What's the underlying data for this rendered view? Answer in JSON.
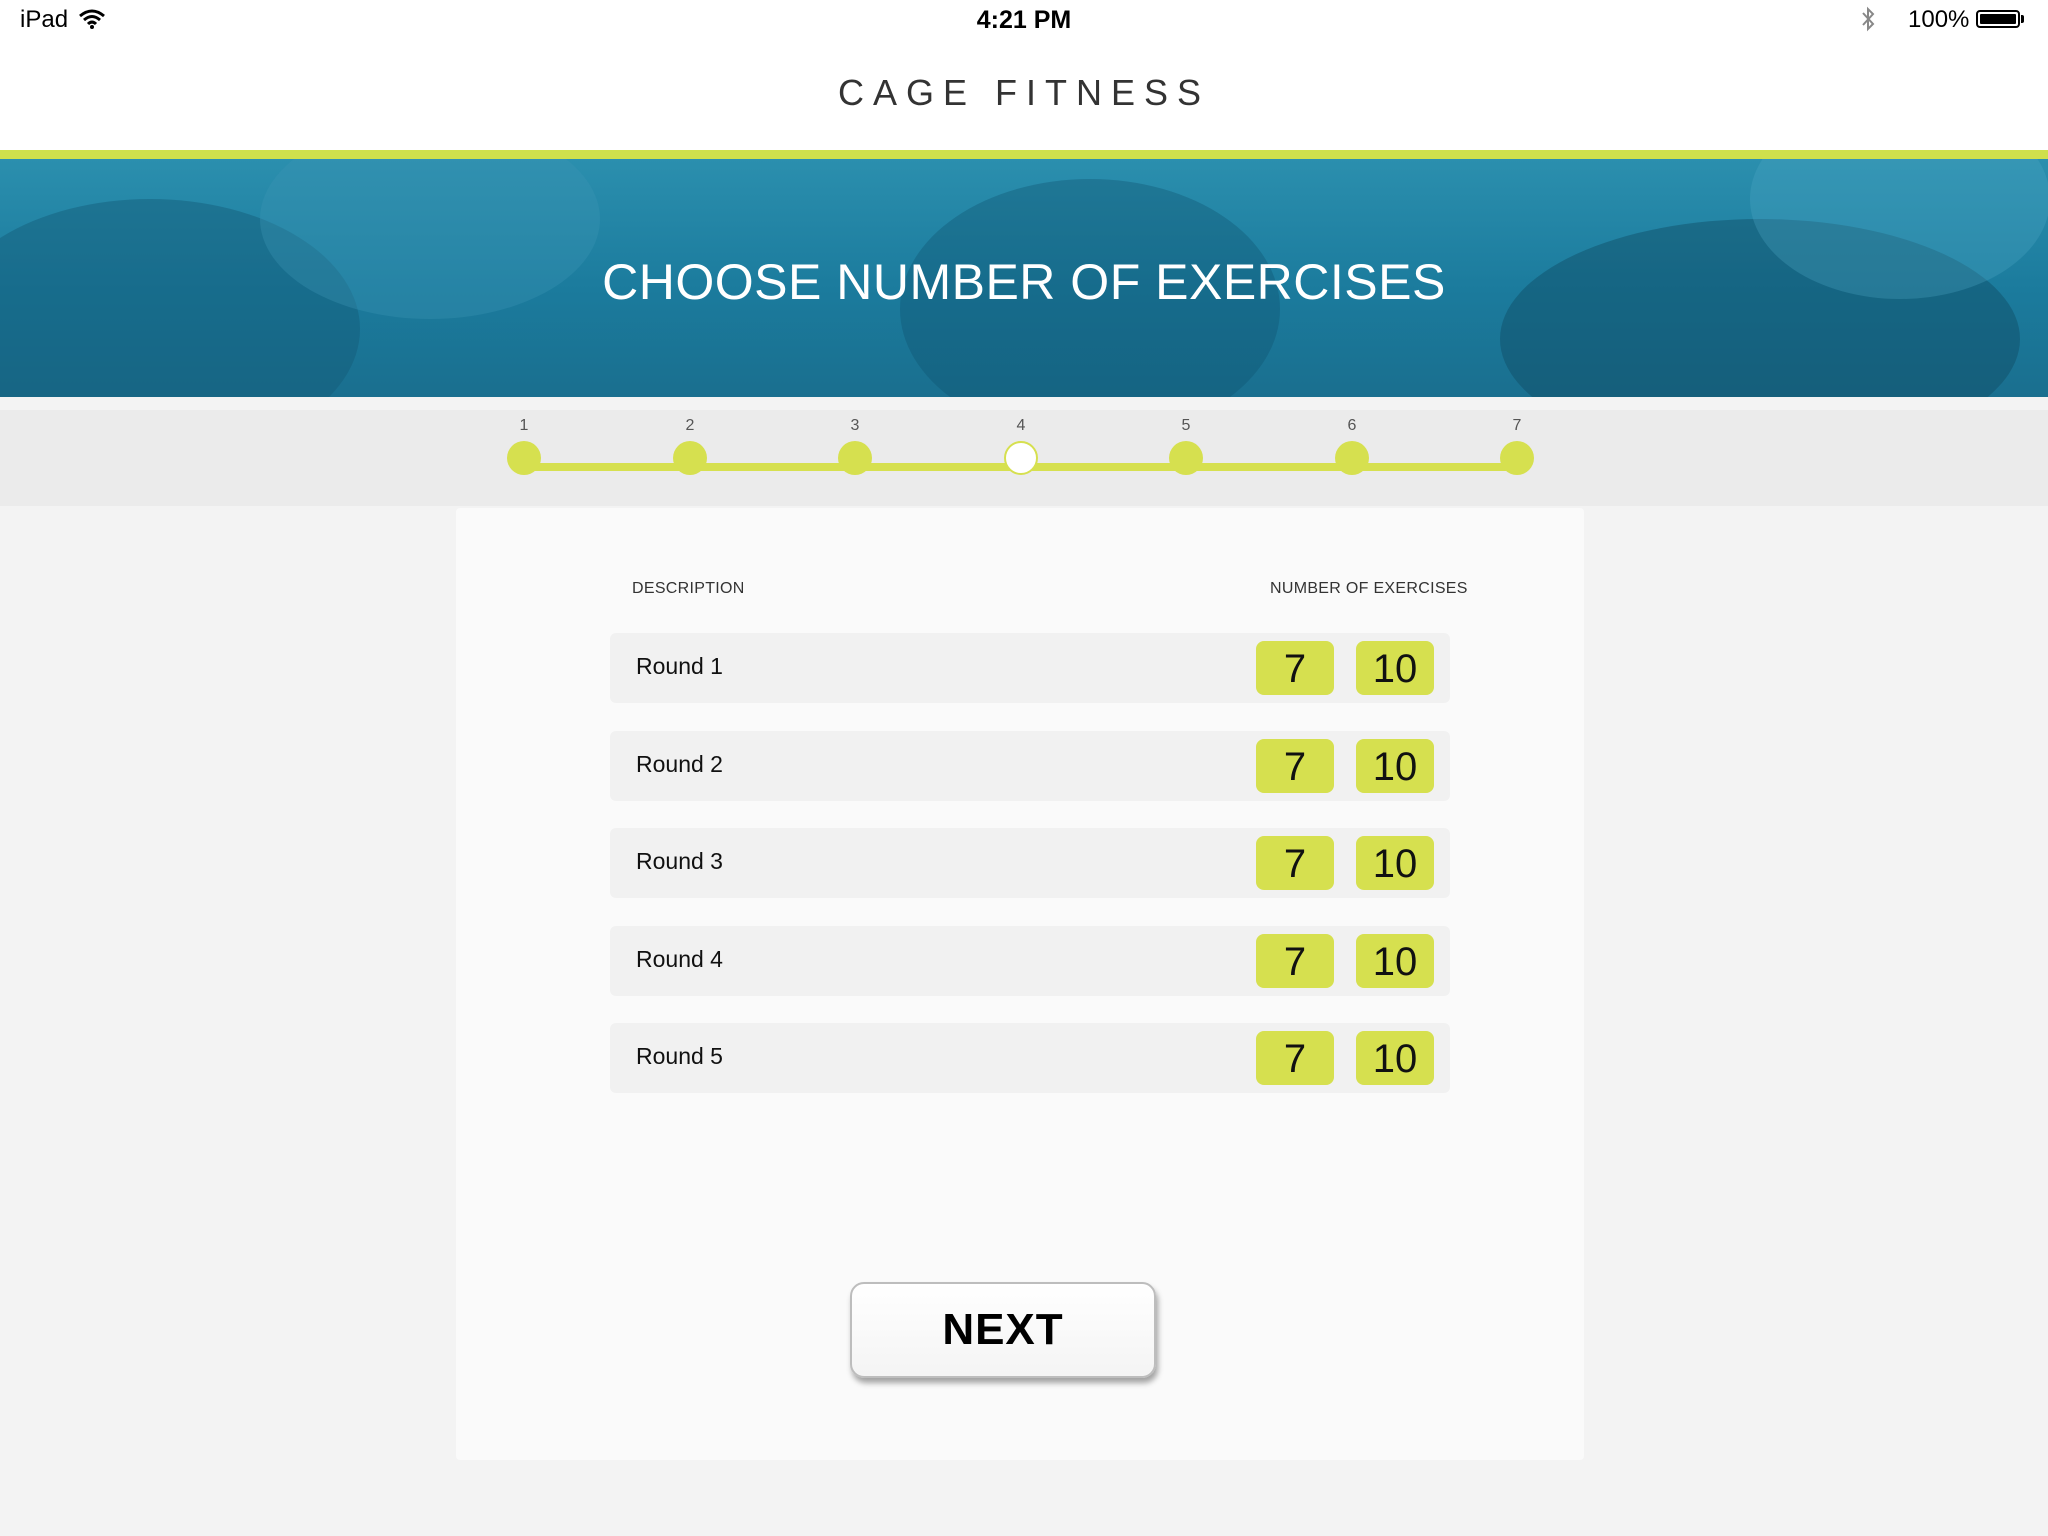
{
  "status_bar": {
    "device": "iPad",
    "time": "4:21 PM",
    "battery": "100%",
    "battery_level": 1.0
  },
  "header": {
    "app_title": "CAGE FITNESS"
  },
  "banner": {
    "title": "CHOOSE NUMBER OF EXERCISES"
  },
  "stepper": {
    "current_step": 4,
    "steps": [
      {
        "label": "1"
      },
      {
        "label": "2"
      },
      {
        "label": "3"
      },
      {
        "label": "4"
      },
      {
        "label": "5"
      },
      {
        "label": "6"
      },
      {
        "label": "7"
      }
    ]
  },
  "table": {
    "columns": {
      "description": "DESCRIPTION",
      "number_of_exercises": "NUMBER OF EXERCISES"
    },
    "rows": [
      {
        "label": "Round 1",
        "value_a": "7",
        "value_b": "10"
      },
      {
        "label": "Round 2",
        "value_a": "7",
        "value_b": "10"
      },
      {
        "label": "Round 3",
        "value_a": "7",
        "value_b": "10"
      },
      {
        "label": "Round 4",
        "value_a": "7",
        "value_b": "10"
      },
      {
        "label": "Round 5",
        "value_a": "7",
        "value_b": "10"
      }
    ]
  },
  "actions": {
    "next_label": "NEXT"
  },
  "colors": {
    "accent": "#cfe04c",
    "banner": "#1b7b9d"
  }
}
